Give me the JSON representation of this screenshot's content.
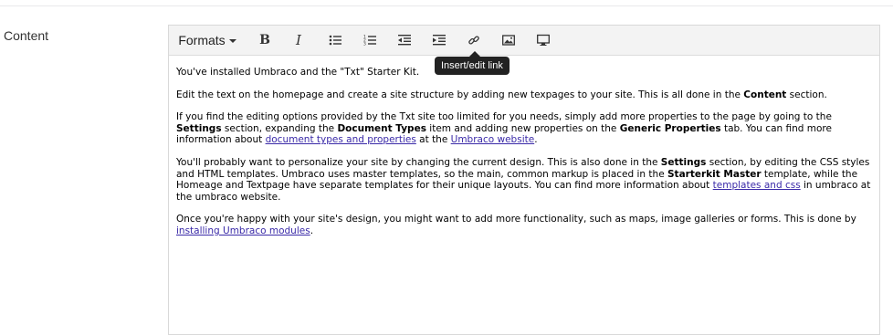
{
  "field": {
    "label": "Content"
  },
  "toolbar": {
    "formats_label": "Formats",
    "bold_label": "B",
    "italic_label": "I",
    "tooltip": "Insert/edit link"
  },
  "content": {
    "p1": "You've installed Umbraco and the \"Txt\" Starter Kit.",
    "p2_a": "Edit the text on the homepage and create a site structure by adding new texpages to your site. This is all done in the ",
    "p2_b": "Content",
    "p2_c": " section.",
    "p3_a": "If you find the editing options provided by the Txt site too limited for you needs, simply add more properties to the page by going to the ",
    "p3_b": "Settings",
    "p3_c": " section, expanding the ",
    "p3_d": "Document Types",
    "p3_e": " item and adding new properties on the ",
    "p3_f": "Generic Properties",
    "p3_g": " tab. You can find more information about ",
    "p3_link1": "document types and properties",
    "p3_h": " at the ",
    "p3_link2": "Umbraco website",
    "p3_i": ".",
    "p4_a": "You'll probably want to personalize your site by changing the current design. This is also done in the ",
    "p4_b": "Settings",
    "p4_c": " section, by editing the CSS styles and HTML templates. Umbraco uses master templates, so the main, common markup is placed in the ",
    "p4_d": "Starterkit Master",
    "p4_e": " template, while the Homeage and Textpage have separate templates for their unique layouts. You can find more information about ",
    "p4_link": "templates and css",
    "p4_f": " in umbraco at the umbraco website.",
    "p5_a": "Once you're happy with your site's design, you might want to add more functionality, such as maps, image galleries or forms. This is done by ",
    "p5_link": "installing Umbraco modules",
    "p5_b": "."
  }
}
